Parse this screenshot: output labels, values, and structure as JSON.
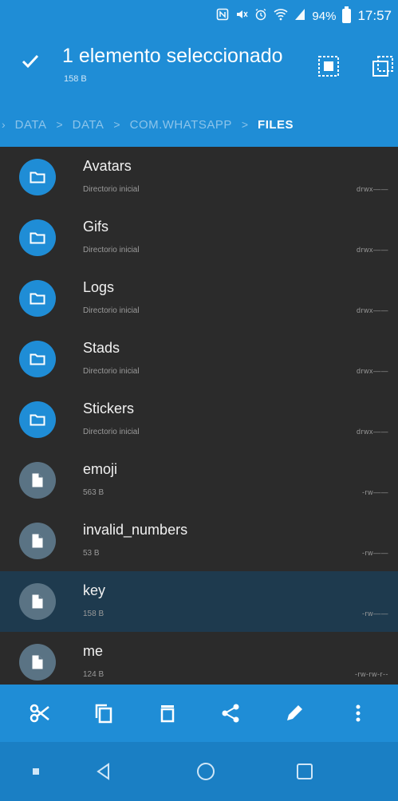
{
  "status_bar": {
    "battery": "94%",
    "time": "17:57"
  },
  "action_bar": {
    "title": "1 elemento seleccionado",
    "subtitle": "158 B"
  },
  "breadcrumb": {
    "items": [
      "DATA",
      "DATA",
      "COM.WHATSAPP",
      "FILES"
    ]
  },
  "files": [
    {
      "name": "Avatars",
      "meta": "Directorio inicial",
      "perm": "drwx——",
      "kind": "folder",
      "selected": false
    },
    {
      "name": "Gifs",
      "meta": "Directorio inicial",
      "perm": "drwx——",
      "kind": "folder",
      "selected": false
    },
    {
      "name": "Logs",
      "meta": "Directorio inicial",
      "perm": "drwx——",
      "kind": "folder",
      "selected": false
    },
    {
      "name": "Stads",
      "meta": "Directorio inicial",
      "perm": "drwx——",
      "kind": "folder",
      "selected": false
    },
    {
      "name": "Stickers",
      "meta": "Directorio inicial",
      "perm": "drwx——",
      "kind": "folder",
      "selected": false
    },
    {
      "name": "emoji",
      "meta": "563 B",
      "perm": "-rw——",
      "kind": "file",
      "selected": false
    },
    {
      "name": "invalid_numbers",
      "meta": "53 B",
      "perm": "-rw——",
      "kind": "file",
      "selected": false
    },
    {
      "name": "key",
      "meta": "158 B",
      "perm": "-rw——",
      "kind": "file",
      "selected": true
    },
    {
      "name": "me",
      "meta": "124 B",
      "perm": "-rw-rw-r--",
      "kind": "file",
      "selected": false
    }
  ],
  "colors": {
    "primary": "#1f8dd6",
    "background": "#2b2b2b",
    "selected_row": "#1e3a4e",
    "file_avatar": "#5a7384"
  },
  "icons": {
    "toolbar": [
      "cut-icon",
      "copy-icon",
      "delete-icon",
      "share-icon",
      "edit-icon",
      "more-icon"
    ],
    "action_bar": [
      "check-icon",
      "select-all-icon",
      "select-inverse-icon"
    ]
  }
}
